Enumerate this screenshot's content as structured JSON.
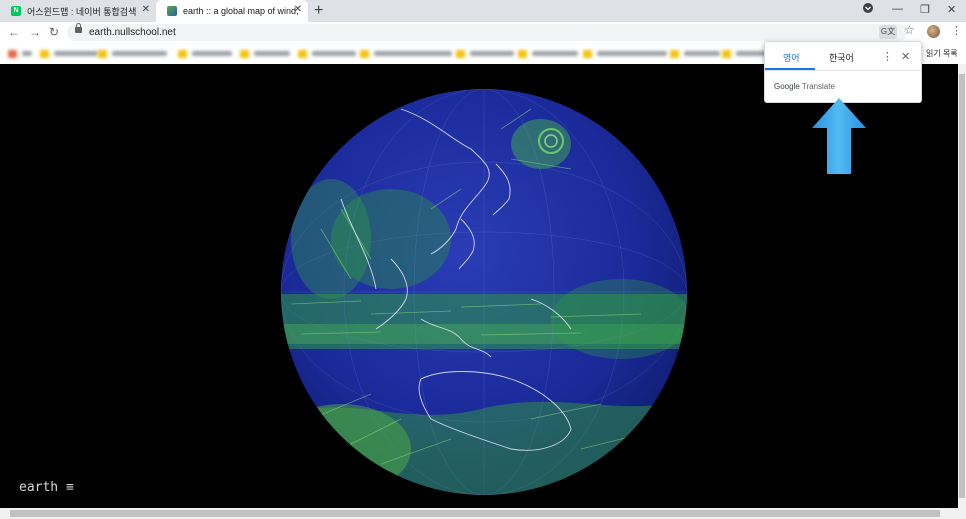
{
  "tabs": [
    {
      "title": "어스윈드맵 : 네이버 통합검색",
      "favicon_color": "#03c75a",
      "favicon_letter": "N",
      "active": false
    },
    {
      "title": "earth :: a global map of wind, w",
      "favicon_color": "#4f8f3a",
      "active": true
    }
  ],
  "toolbar": {
    "url": "earth.nullschool.net"
  },
  "bookmarks": {
    "reading_list": "읽기 목록"
  },
  "page": {
    "brand": "earth ≡"
  },
  "translate_popup": {
    "source_lang": "영어",
    "target_lang": "한국어",
    "google_word": "Google",
    "translate_word": "Translate"
  },
  "colors": {
    "accent": "#1a73e8",
    "arrow": "#3aa9ee",
    "ocean": "#1b2a9a",
    "wind": "#3fb24a"
  },
  "icons": [
    "back-icon",
    "forward-icon",
    "reload-icon",
    "lock-icon",
    "translate-icon",
    "star-icon",
    "profile-avatar",
    "more-icon",
    "close-icon",
    "minimize-icon",
    "restore-icon"
  ]
}
